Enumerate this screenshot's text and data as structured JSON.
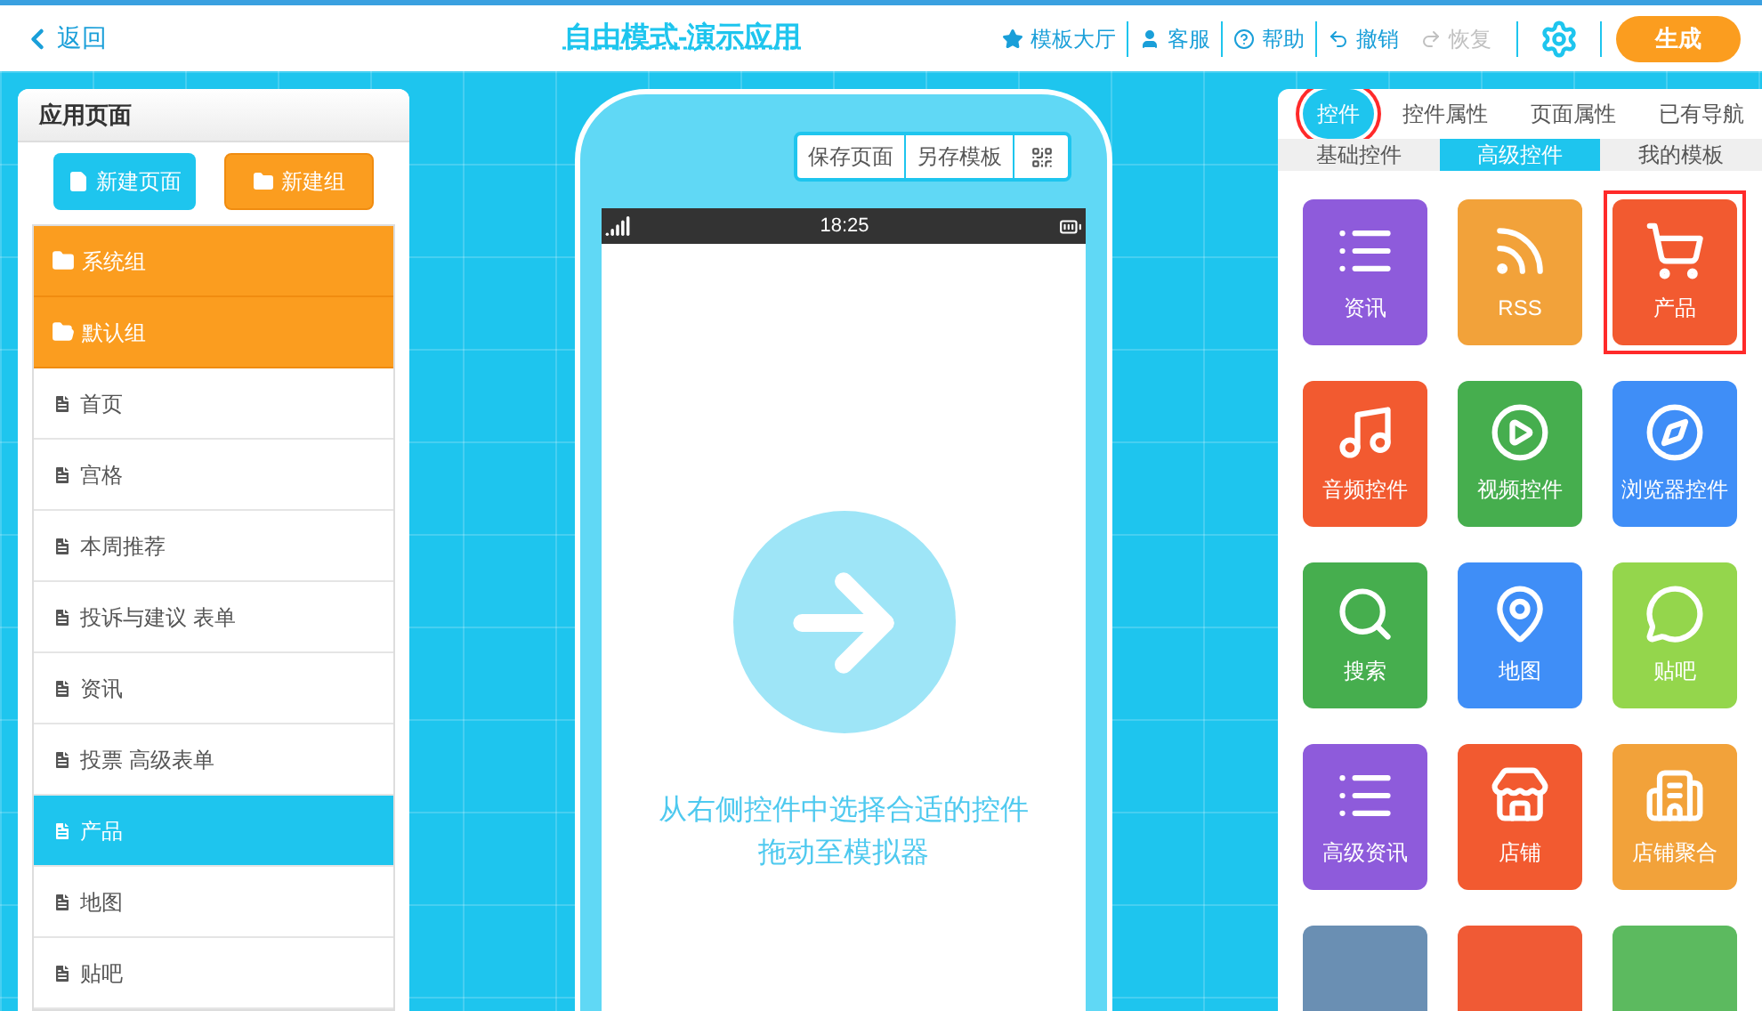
{
  "topbar": {
    "back": "返回",
    "title": "自由模式-演示应用",
    "actions": [
      {
        "kind": "star",
        "label": "模板大厅",
        "disabled": false
      },
      {
        "kind": "user",
        "label": "客服",
        "disabled": false
      },
      {
        "kind": "help",
        "label": "帮助",
        "disabled": false
      },
      {
        "kind": "undo",
        "label": "撤销",
        "disabled": false
      },
      {
        "kind": "redo",
        "label": "恢复",
        "disabled": true
      }
    ],
    "generate": "生成"
  },
  "pages_panel": {
    "title": "应用页面",
    "new_page": "新建页面",
    "new_group": "新建组",
    "groups": [
      {
        "label": "系统组",
        "expanded": false
      },
      {
        "label": "默认组",
        "expanded": true,
        "children": [
          {
            "label": "首页",
            "selected": false
          },
          {
            "label": "宫格",
            "selected": false
          },
          {
            "label": "本周推荐",
            "selected": false
          },
          {
            "label": "投诉与建议 表单",
            "selected": false
          },
          {
            "label": "资讯",
            "selected": false
          },
          {
            "label": "投票 高级表单",
            "selected": false
          },
          {
            "label": "产品",
            "selected": true
          },
          {
            "label": "地图",
            "selected": false
          },
          {
            "label": "贴吧",
            "selected": false
          }
        ]
      }
    ]
  },
  "simulator": {
    "toolbar": [
      "保存页面",
      "另存模板"
    ],
    "time": "18:25",
    "hint": [
      "从右侧控件中选择合适的控件",
      "拖动至模拟器"
    ]
  },
  "controls_panel": {
    "tabs": [
      {
        "label": "控件",
        "selected": true,
        "highlighted": true
      },
      {
        "label": "控件属性",
        "selected": false,
        "highlighted": false
      },
      {
        "label": "页面属性",
        "selected": false,
        "highlighted": false
      },
      {
        "label": "已有导航",
        "selected": false,
        "highlighted": false
      }
    ],
    "subtabs": [
      {
        "label": "基础控件",
        "selected": false
      },
      {
        "label": "高级控件",
        "selected": true
      },
      {
        "label": "我的模板",
        "selected": false
      }
    ],
    "tiles": [
      {
        "kind": "list",
        "label": "资讯",
        "color": "#8e5bdb",
        "highlighted": false
      },
      {
        "kind": "rss",
        "label": "RSS",
        "color": "#f2a23a",
        "highlighted": false
      },
      {
        "kind": "cart",
        "label": "产品",
        "color": "#f25a30",
        "highlighted": true
      },
      {
        "kind": "music",
        "label": "音频控件",
        "color": "#f25a30",
        "highlighted": false
      },
      {
        "kind": "play",
        "label": "视频控件",
        "color": "#46ae4e",
        "highlighted": false
      },
      {
        "kind": "compass",
        "label": "浏览器控件",
        "color": "#3f8ef7",
        "highlighted": false
      },
      {
        "kind": "search",
        "label": "搜索",
        "color": "#46ae4e",
        "highlighted": false
      },
      {
        "kind": "pin",
        "label": "地图",
        "color": "#3f8ef7",
        "highlighted": false
      },
      {
        "kind": "chat",
        "label": "贴吧",
        "color": "#94d64c",
        "highlighted": false
      },
      {
        "kind": "pro",
        "label": "高级资讯",
        "color": "#8e5bdb",
        "highlighted": false
      },
      {
        "kind": "store",
        "label": "店铺",
        "color": "#f25a30",
        "highlighted": false
      },
      {
        "kind": "mall",
        "label": "店铺聚合",
        "color": "#f2a23a",
        "highlighted": false
      },
      {
        "kind": "blank",
        "color": "#6a8fb3",
        "highlighted": false
      },
      {
        "kind": "blank",
        "color": "#f05a35",
        "highlighted": false
      },
      {
        "kind": "blank",
        "color": "#5cba5f",
        "highlighted": false
      }
    ]
  }
}
